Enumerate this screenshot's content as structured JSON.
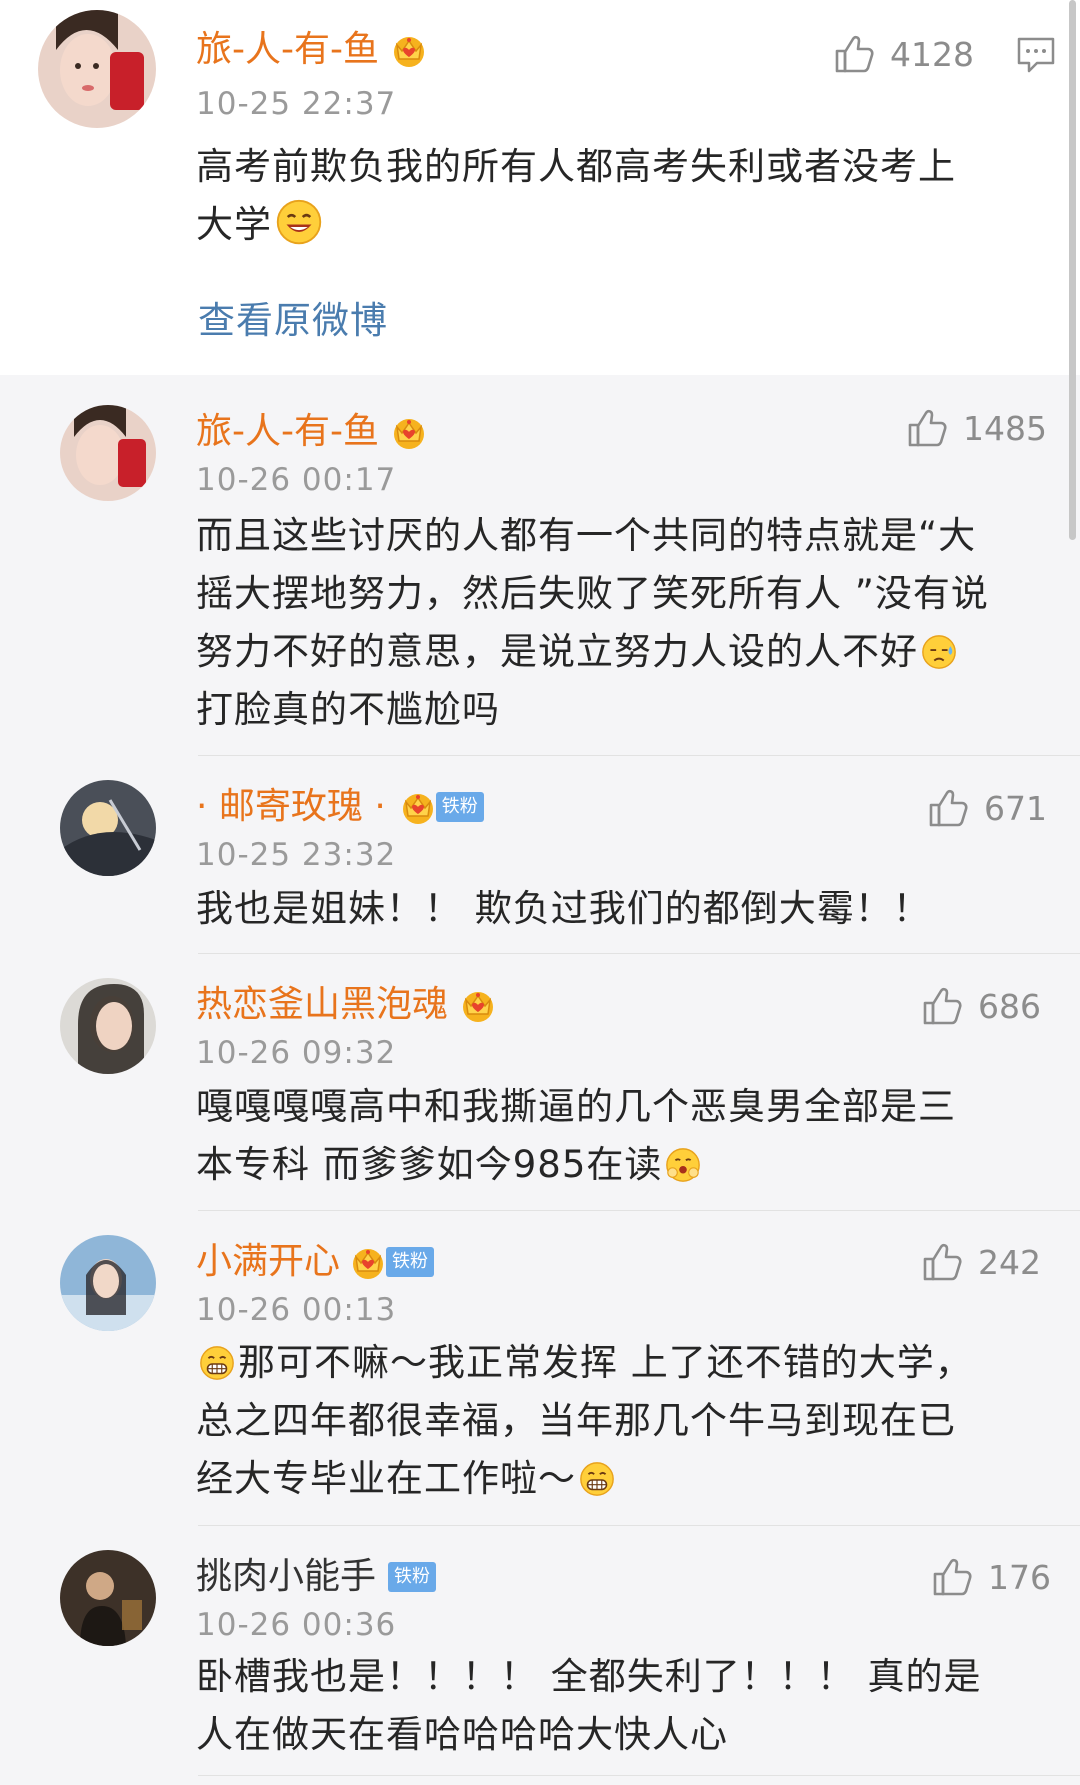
{
  "main_comment": {
    "user": "旅-人-有-鱼",
    "time": "10-25 22:37",
    "likes": "4128",
    "text_line1": "高考前欺负我的所有人都高考失利或者没考上",
    "text_line2": "大学",
    "view_original": "查看原微博"
  },
  "replies": [
    {
      "user": "旅-人-有-鱼",
      "time": "10-26 00:17",
      "likes": "1485",
      "lines": [
        "而且这些讨厌的人都有一个共同的特点就是“大",
        "摇大摆地努力，然后失败了笑死所有人 ”没有说",
        "努力不好的意思，是说立努力人设的人不好",
        "打脸真的不尴尬吗"
      ]
    },
    {
      "user": "· 邮寄玫瑰 ·",
      "fan_badge": "铁粉",
      "time": "10-25 23:32",
      "likes": "671",
      "lines": [
        "我也是姐妹！！ 欺负过我们的都倒大霉！！"
      ]
    },
    {
      "user": "热恋釜山黑泡魂",
      "time": "10-26 09:32",
      "likes": "686",
      "lines": [
        "嘎嘎嘎嘎高中和我撕逼的几个恶臭男全部是三",
        "本专科 而爹爹如今985在读"
      ]
    },
    {
      "user": "小满开心",
      "fan_badge": "铁粉",
      "time": "10-26 00:13",
      "likes": "242",
      "lines": [
        "那可不嘛～我正常发挥 上了还不错的大学，",
        "总之四年都很幸福，当年那几个牛马到现在已",
        "经大专毕业在工作啦～"
      ]
    },
    {
      "user": "挑肉小能手",
      "fan_badge": "铁粉",
      "time": "10-26 00:36",
      "likes": "176",
      "lines": [
        "卧槽我也是！！！！ 全都失利了！！！ 真的是",
        "人在做天在看哈哈哈哈大快人心"
      ]
    }
  ],
  "colors": {
    "username": "#e8741c",
    "link": "#4a7cae",
    "badge": "#69a9e9",
    "background": "#f5f5f7"
  },
  "icons": [
    "thumbs-up-icon",
    "comment-icon",
    "crown-badge-icon",
    "emoji-icon"
  ]
}
